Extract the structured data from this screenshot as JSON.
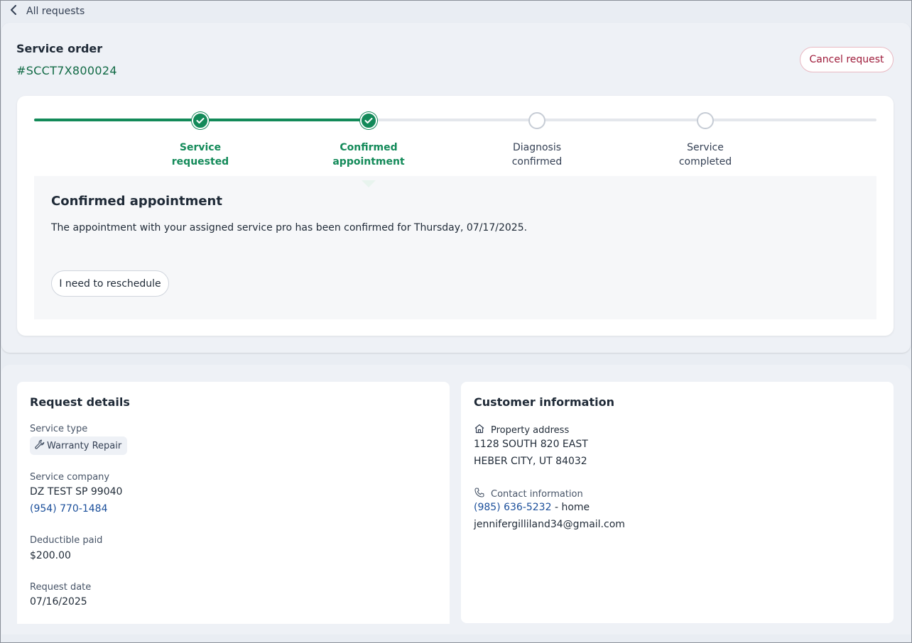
{
  "nav": {
    "back_label": "All requests"
  },
  "order": {
    "title": "Service order",
    "number": "#SCCT7X800024",
    "cancel_label": "Cancel request"
  },
  "progress": {
    "steps": [
      {
        "line1": "Service",
        "line2": "requested",
        "status": "done"
      },
      {
        "line1": "Confirmed",
        "line2": "appointment",
        "status": "done"
      },
      {
        "line1": "Diagnosis",
        "line2": "confirmed",
        "status": "todo"
      },
      {
        "line1": "Service",
        "line2": "completed",
        "status": "todo"
      }
    ],
    "colors": {
      "done": "#138a59",
      "todo": "#c6ccd5"
    }
  },
  "current_step": {
    "title": "Confirmed appointment",
    "message": "The appointment with your assigned service pro has been confirmed for Thursday, 07/17/2025.",
    "reschedule_label": "I need to reschedule"
  },
  "request_details": {
    "title": "Request details",
    "service_type_label": "Service type",
    "service_type_icon": "wrench-icon",
    "service_type_value": "Warranty Repair",
    "service_company_label": "Service company",
    "service_company_name": "DZ TEST SP 99040",
    "service_company_phone": "(954) 770-1484",
    "deductible_label": "Deductible paid",
    "deductible_value": "$200.00",
    "request_date_label": "Request date",
    "request_date_value": "07/16/2025"
  },
  "customer_info": {
    "title": "Customer information",
    "address_icon": "home-icon",
    "address_label": "Property address",
    "address_line1": "1128 SOUTH 820 EAST",
    "address_line2": "HEBER CITY, UT 84032",
    "contact_icon": "phone-icon",
    "contact_label": "Contact information",
    "phone": "(985) 636-5232",
    "phone_suffix": " - home",
    "email": "jennifergilliland34@gmail.com"
  }
}
